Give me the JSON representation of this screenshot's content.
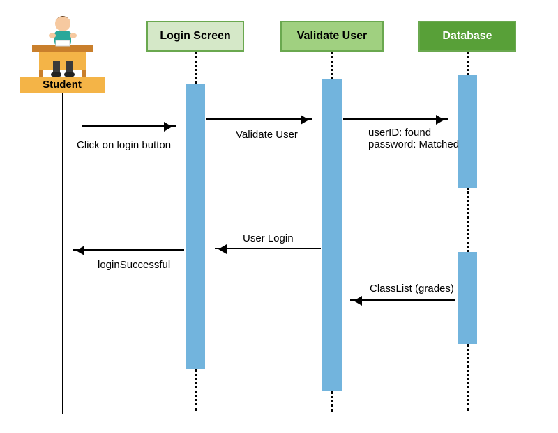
{
  "actor": {
    "label": "Student"
  },
  "participants": {
    "loginScreen": {
      "label": "Login Screen"
    },
    "validateUser": {
      "label": "Validate User"
    },
    "database": {
      "label": "Database"
    }
  },
  "messages": {
    "clickLogin": "Click on login button",
    "validateUser": "Validate User",
    "userCheck": "userID: found\npassword: Matched",
    "userLogin": "User Login",
    "loginSuccessful": "loginSuccessful",
    "classList": "ClassList (grades)"
  },
  "colors": {
    "boxBorder": "#6aa84f",
    "loginScreenFill": "#d5e8c8",
    "validateUserFill": "#a0d080",
    "databaseFill": "#58a038",
    "activation": "#72b4dd",
    "desk": "#f4b447"
  }
}
